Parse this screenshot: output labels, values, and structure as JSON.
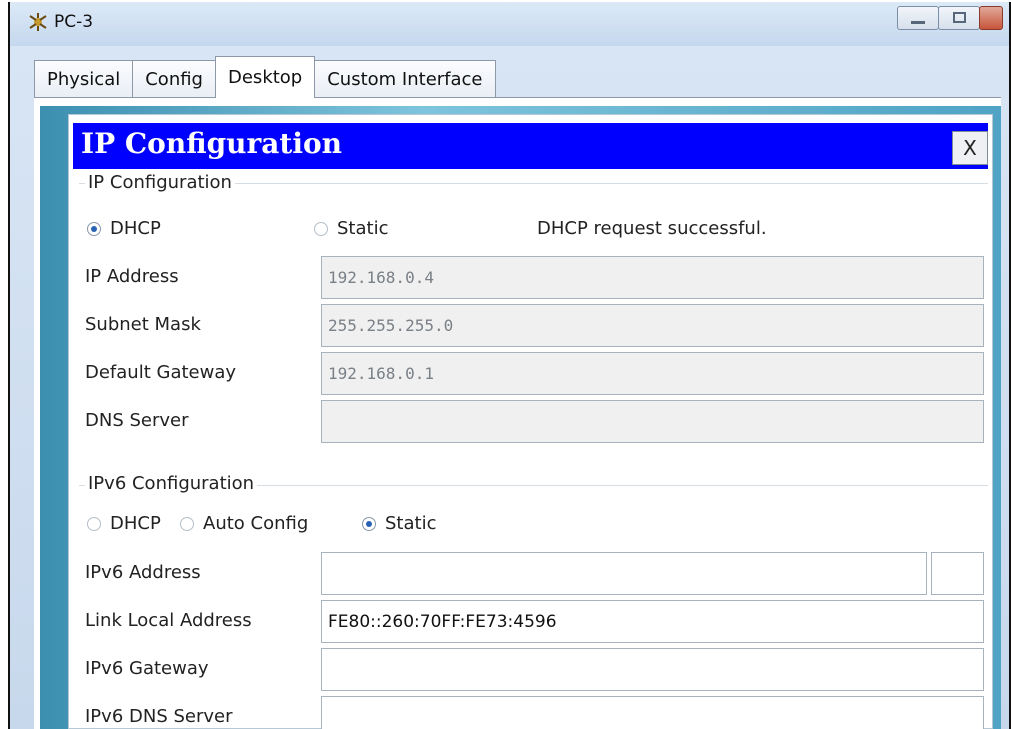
{
  "window": {
    "title": "PC-3",
    "app_icon": "packet-tracer-pc-icon"
  },
  "tabs": [
    {
      "label": "Physical",
      "active": false
    },
    {
      "label": "Config",
      "active": false
    },
    {
      "label": "Desktop",
      "active": true
    },
    {
      "label": "Custom Interface",
      "active": false
    }
  ],
  "panel": {
    "title": "IP Configuration",
    "close_label": "X",
    "header_color": "#0000ff"
  },
  "ipv4": {
    "group_label": "IP Configuration",
    "dhcp_label": "DHCP",
    "static_label": "Static",
    "mode": "DHCP",
    "status": "DHCP request successful.",
    "ip_address_label": "IP Address",
    "ip_address": "192.168.0.4",
    "subnet_mask_label": "Subnet Mask",
    "subnet_mask": "255.255.255.0",
    "gateway_label": "Default Gateway",
    "gateway": "192.168.0.1",
    "dns_label": "DNS Server",
    "dns": ""
  },
  "ipv6": {
    "group_label": "IPv6 Configuration",
    "dhcp_label": "DHCP",
    "auto_label": "Auto Config",
    "static_label": "Static",
    "mode": "Static",
    "address_label": "IPv6 Address",
    "address": "",
    "prefix_separator": "/",
    "prefix": "",
    "link_local_label": "Link Local Address",
    "link_local": "FE80::260:70FF:FE73:4596",
    "gateway_label": "IPv6 Gateway",
    "gateway": "",
    "dns_label": "IPv6 DNS Server",
    "dns": ""
  }
}
